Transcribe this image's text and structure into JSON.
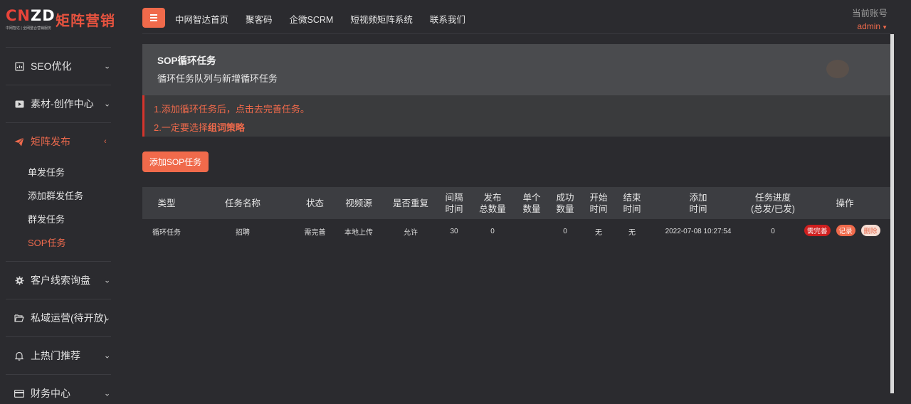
{
  "logo": {
    "mark_c": "CN",
    "mark_rest": "ZD",
    "tagline": "中网智达 | 全网整合营销服务",
    "brand": "矩阵营销"
  },
  "sidebar": {
    "items": [
      {
        "label": "SEO优化",
        "icon": "document-chart-icon",
        "chevron": "⌄"
      },
      {
        "label": "素材-创作中心",
        "icon": "video-icon",
        "chevron": "⌄"
      },
      {
        "label": "矩阵发布",
        "icon": "paper-plane-icon",
        "chevron": "‹",
        "active": true,
        "children": [
          "单发任务",
          "添加群发任务",
          "群发任务",
          "SOP任务"
        ],
        "active_child": "SOP任务"
      },
      {
        "label": "客户线索询盘",
        "icon": "gear-icon",
        "chevron": "⌄"
      },
      {
        "label": "私域运营(待开放)",
        "icon": "folder-open-icon",
        "chevron": "⌄"
      },
      {
        "label": "上热门推荐",
        "icon": "bell-icon",
        "chevron": "⌄"
      },
      {
        "label": "财务中心",
        "icon": "credit-card-icon",
        "chevron": "⌄"
      }
    ]
  },
  "topnav": {
    "links": [
      "中网智达首页",
      "聚客码",
      "企微SCRM",
      "短视频矩阵系统",
      "联系我们"
    ],
    "account_label": "当前账号",
    "account_user": "admin"
  },
  "page": {
    "title": "SOP循环任务",
    "subtitle": "循环任务队列与新增循环任务",
    "notice_line1": "1.添加循环任务后，点击去完善任务。",
    "notice_line2_prefix": "2.一定要选择",
    "notice_line2_bold": "组词策略",
    "add_button": "添加SOP任务"
  },
  "table": {
    "headers": [
      "类型",
      "任务名称",
      "状态",
      "视频源",
      "是否重复",
      "间隔\n时间",
      "发布\n总数量",
      "单个\n数量",
      "成功\n数量",
      "开始\n时间",
      "结束\n时间",
      "添加\n时间",
      "任务进度\n(总发/已发)",
      "操作"
    ],
    "rows": [
      {
        "type": "循环任务",
        "name": "招聘",
        "status": "需完善",
        "source": "本地上传",
        "repeat": "允许",
        "interval": "30",
        "total": "0",
        "single": "",
        "success": "0",
        "start": "无",
        "end": "无",
        "added": "2022-07-08 10:27:54",
        "progress": "0",
        "ops": [
          "需完善",
          "记录",
          "删除"
        ]
      }
    ]
  },
  "colors": {
    "accent": "#f06a4b",
    "danger": "#cf1f1f",
    "background": "#2b2b2f"
  }
}
